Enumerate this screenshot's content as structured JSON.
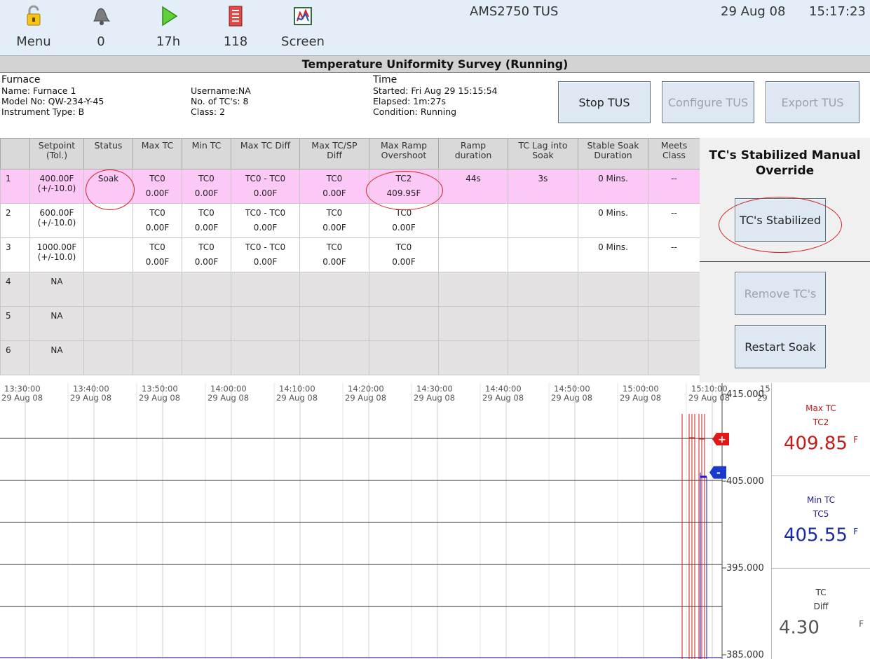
{
  "toolbar": {
    "menu_label": "Menu",
    "alarm_label": "0",
    "run_label": "17h",
    "log_label": "118",
    "screen_label": "Screen",
    "title": "AMS2750 TUS",
    "date": "29 Aug 08",
    "time": "15:17:23",
    "icons": [
      "menu-lock-icon",
      "bell-icon",
      "play-icon",
      "log-icon",
      "screen-chart-icon"
    ]
  },
  "survey_title": "Temperature Uniformity Survey (Running)",
  "furnace": {
    "heading": "Furnace",
    "name": "Name: Furnace 1",
    "model": "Model No: QW-234-Y-45",
    "instrument": "Instrument Type: B",
    "username": "Username:NA",
    "tcs": "No. of TC's: 8",
    "class": "Class: 2"
  },
  "time_info": {
    "heading": "Time",
    "started": "Started: Fri Aug 29 15:15:54",
    "elapsed": "Elapsed: 1m:27s",
    "condition": "Condition: Running"
  },
  "buttons": {
    "stop": "Stop TUS",
    "configure": "Configure TUS",
    "export": "Export TUS"
  },
  "table": {
    "headers": [
      {
        "l1": "",
        "l2": ""
      },
      {
        "l1": "Setpoint",
        "l2": "(Tol.)"
      },
      {
        "l1": "Status",
        "l2": ""
      },
      {
        "l1": "Max TC",
        "l2": ""
      },
      {
        "l1": "Min TC",
        "l2": ""
      },
      {
        "l1": "Max TC Diff",
        "l2": ""
      },
      {
        "l1": "Max TC/SP",
        "l2": "Diff"
      },
      {
        "l1": "Max Ramp",
        "l2": "Overshoot"
      },
      {
        "l1": "Ramp",
        "l2": "duration"
      },
      {
        "l1": "TC Lag into",
        "l2": "Soak"
      },
      {
        "l1": "Stable Soak",
        "l2": "Duration"
      },
      {
        "l1": "Meets",
        "l2": "Class"
      }
    ],
    "rows": [
      {
        "num": "1",
        "sp": "400.00F",
        "tol": "(+/-10.0)",
        "status": "Soak",
        "max_tc": "TC0",
        "max_tc_v": "0.00F",
        "min_tc": "TC0",
        "min_tc_v": "0.00F",
        "diff": "TC0 - TC0",
        "diff_v": "0.00F",
        "sp_diff": "TC0",
        "sp_diff_v": "0.00F",
        "ramp_os": "TC2",
        "ramp_os_v": "409.95F",
        "ramp_dur": "44s",
        "lag": "3s",
        "soak": "0 Mins.",
        "meets": "--"
      },
      {
        "num": "2",
        "sp": "600.00F",
        "tol": "(+/-10.0)",
        "status": "",
        "max_tc": "TC0",
        "max_tc_v": "0.00F",
        "min_tc": "TC0",
        "min_tc_v": "0.00F",
        "diff": "TC0 - TC0",
        "diff_v": "0.00F",
        "sp_diff": "TC0",
        "sp_diff_v": "0.00F",
        "ramp_os": "TC0",
        "ramp_os_v": "0.00F",
        "ramp_dur": "",
        "lag": "",
        "soak": "0 Mins.",
        "meets": "--"
      },
      {
        "num": "3",
        "sp": "1000.00F",
        "tol": "(+/-10.0)",
        "status": "",
        "max_tc": "TC0",
        "max_tc_v": "0.00F",
        "min_tc": "TC0",
        "min_tc_v": "0.00F",
        "diff": "TC0 - TC0",
        "diff_v": "0.00F",
        "sp_diff": "TC0",
        "sp_diff_v": "0.00F",
        "ramp_os": "TC0",
        "ramp_os_v": "0.00F",
        "ramp_dur": "",
        "lag": "",
        "soak": "0 Mins.",
        "meets": "--"
      },
      {
        "num": "4",
        "sp": "NA"
      },
      {
        "num": "5",
        "sp": "NA"
      },
      {
        "num": "6",
        "sp": "NA"
      }
    ]
  },
  "override": {
    "title_line1": "TC's Stabilized Manual",
    "title_line2": "Override",
    "stabilized": "TC's Stabilized",
    "remove": "Remove TC's",
    "restart": "Restart Soak"
  },
  "chart_data": {
    "type": "line",
    "x_ticks": [
      {
        "time": "13:30:00",
        "date": "29 Aug 08"
      },
      {
        "time": "13:40:00",
        "date": "29 Aug 08"
      },
      {
        "time": "13:50:00",
        "date": "29 Aug 08"
      },
      {
        "time": "14:00:00",
        "date": "29 Aug 08"
      },
      {
        "time": "14:10:00",
        "date": "29 Aug 08"
      },
      {
        "time": "14:20:00",
        "date": "29 Aug 08"
      },
      {
        "time": "14:30:00",
        "date": "29 Aug 08"
      },
      {
        "time": "14:40:00",
        "date": "29 Aug 08"
      },
      {
        "time": "14:50:00",
        "date": "29 Aug 08"
      },
      {
        "time": "15:00:00",
        "date": "29 Aug 08"
      },
      {
        "time": "15:10:00",
        "date": "29 Aug 08"
      },
      {
        "time": "15",
        "date": "29"
      }
    ],
    "y_ticks": [
      "415.000",
      "405.000",
      "395.000",
      "385.000"
    ],
    "ylim": [
      385,
      415
    ],
    "upper_limit": 410,
    "lower_limit": 390,
    "markers": {
      "plus": "+",
      "minus": "-"
    },
    "colors": {
      "red": "#cc1a1a",
      "blue": "#1a1acc"
    }
  },
  "readouts": {
    "max": {
      "label": "Max TC",
      "tc": "TC2",
      "value": "409.85",
      "unit": "F"
    },
    "min": {
      "label": "Min TC",
      "tc": "TC5",
      "value": "405.55",
      "unit": "F"
    },
    "diff": {
      "label": "TC",
      "tc": "Diff",
      "value": "4.30",
      "unit": "F"
    }
  }
}
